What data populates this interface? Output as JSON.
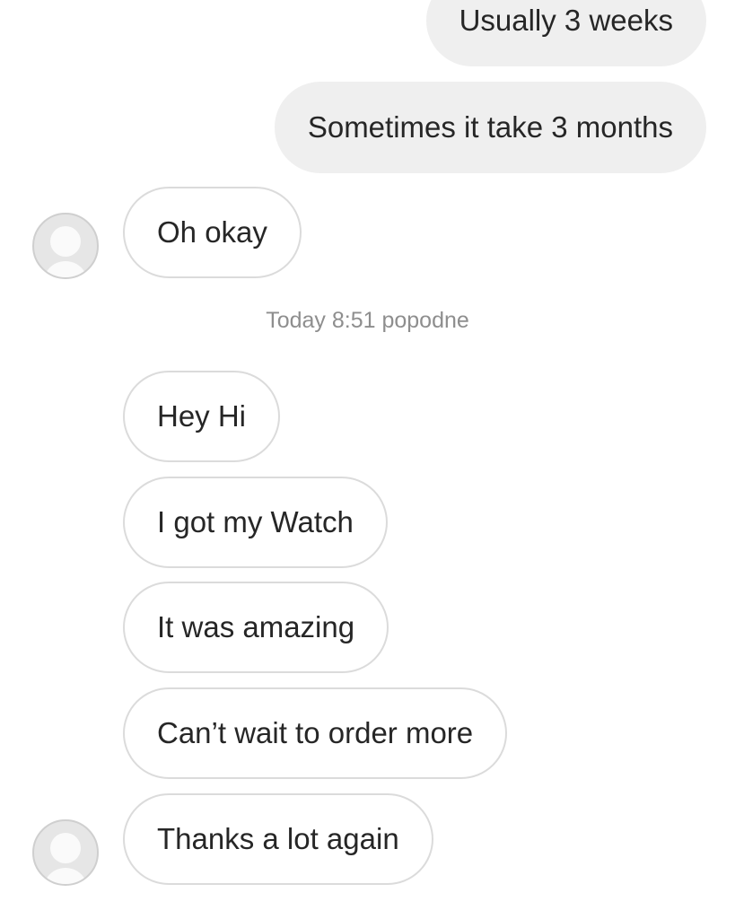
{
  "messages": {
    "out_1": "Usually 3 weeks",
    "out_2": "Sometimes it take 3 months",
    "in_1": "Oh okay",
    "timestamp": "Today 8:51 popodne",
    "in_2": "Hey Hi",
    "in_3": "I got my Watch",
    "in_4": "It was amazing",
    "in_5": "Can’t wait to order more",
    "in_6": "Thanks a lot again"
  },
  "icons": {
    "avatar": "user-avatar-icon"
  },
  "colors": {
    "outgoing_bubble": "#efefef",
    "incoming_bubble_border": "#dbdbdb",
    "text": "#262626",
    "timestamp": "#8e8e8e"
  }
}
